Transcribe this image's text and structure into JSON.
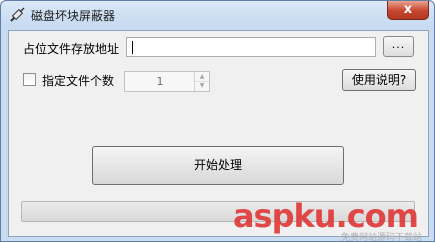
{
  "window": {
    "title": "磁盘坏块屏蔽器",
    "close_glyph": "x",
    "app_icon": "syringe-icon"
  },
  "form": {
    "path_label": "占位文件存放地址",
    "path_value": "",
    "browse_label": "...",
    "count_checkbox_checked": false,
    "count_label": "指定文件个数",
    "count_value": "1",
    "help_label": "使用说明?",
    "start_label": "开始处理"
  },
  "progress": {
    "percent": 0
  },
  "watermark": {
    "text": "aspku.com",
    "subtext": "免费网站源码下载站"
  },
  "colors": {
    "title_bar": "#c5d9f0",
    "close_button": "#c5462e",
    "client_bg": "#f0f0f0",
    "watermark": "#e03a3a"
  }
}
